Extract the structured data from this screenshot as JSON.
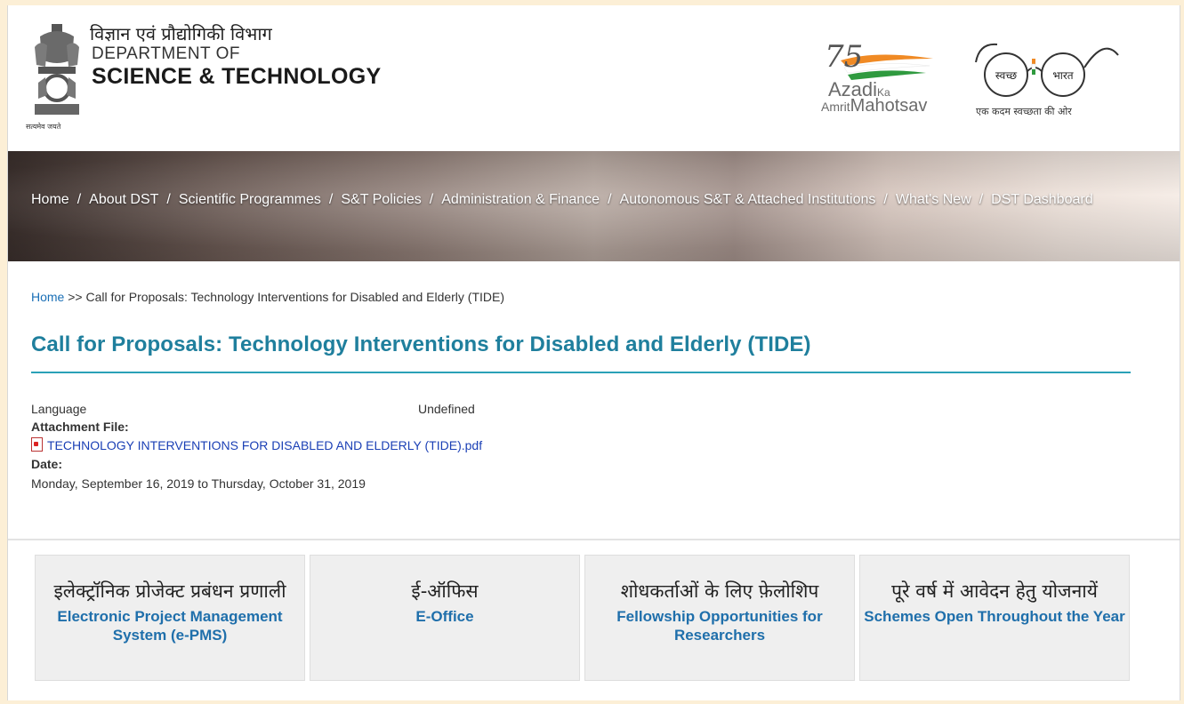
{
  "header": {
    "dept_hindi": "विज्ञान एवं प्रौद्योगिकी विभाग",
    "dept_line1": "DEPARTMENT OF",
    "dept_line2": "SCIENCE & TECHNOLOGY",
    "emblem_caption": "सत्यमेव जयते",
    "azadi": {
      "number": "75",
      "word": "Azadi",
      "ka": "Ka",
      "amrit": "Amrit",
      "mahotsav": "Mahotsav"
    },
    "swachh": {
      "left": "स्वच्छ",
      "right": "भारत",
      "caption": "एक कदम स्वच्छता की ओर"
    }
  },
  "nav": {
    "items": [
      {
        "label": "Home"
      },
      {
        "label": "About DST"
      },
      {
        "label": "Scientific Programmes"
      },
      {
        "label": "S&T Policies"
      },
      {
        "label": "Administration & Finance"
      },
      {
        "label": "Autonomous S&T & Attached Institutions"
      },
      {
        "label": "What's New"
      },
      {
        "label": "DST Dashboard"
      }
    ],
    "separator": "/"
  },
  "breadcrumb": {
    "home": "Home",
    "separator": ">>",
    "current": "Call for Proposals: Technology Interventions for Disabled and Elderly (TIDE)"
  },
  "page_title": "Call for Proposals: Technology Interventions for Disabled and Elderly (TIDE)",
  "details": {
    "language_label": "Language",
    "language_value": "Undefined",
    "attachment_label": "Attachment File:",
    "attachment_name": "TECHNOLOGY INTERVENTIONS FOR DISABLED AND ELDERLY (TIDE).pdf",
    "date_label": "Date:",
    "date_value": "Monday, September 16, 2019 to Thursday, October 31, 2019"
  },
  "tiles": [
    {
      "hindi": "इलेक्ट्रॉनिक प्रोजेक्ट प्रबंधन प्रणाली",
      "english": "Electronic Project Management System (e-PMS)"
    },
    {
      "hindi": "ई-ऑफिस",
      "english": "E-Office"
    },
    {
      "hindi": "शोधकर्ताओं के लिए फ़ेलोशिप",
      "english": "Fellowship Opportunities for Researchers"
    },
    {
      "hindi": "पूरे वर्ष में आवेदन हेतु योजनायें",
      "english": "Schemes Open Throughout the Year"
    }
  ],
  "colors": {
    "title": "#1f7f9d",
    "link": "#1a6fb6",
    "tile_text": "#1f6fab",
    "background_outer": "#fcefd6"
  }
}
